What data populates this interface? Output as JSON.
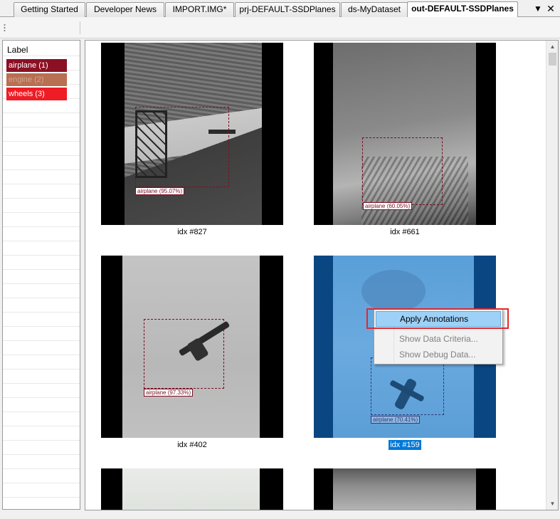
{
  "tabs": [
    {
      "label": "Getting Started",
      "active": false
    },
    {
      "label": "Developer News",
      "active": false
    },
    {
      "label": "IMPORT.IMG*",
      "active": false
    },
    {
      "label": "prj-DEFAULT-SSDPlanes",
      "active": false
    },
    {
      "label": "ds-MyDataset",
      "active": false
    },
    {
      "label": "out-DEFAULT-SSDPlanes",
      "active": true
    }
  ],
  "tab_controls": {
    "dropdown_icon": "chevron-down-icon",
    "close_icon": "close-icon"
  },
  "label_panel": {
    "header": "Label",
    "items": [
      {
        "label": "airplane (1)",
        "color": "#8b1024"
      },
      {
        "label": "engine (2)",
        "color": "#b86f52"
      },
      {
        "label": "wheels (3)",
        "color": "#ee1c25"
      }
    ]
  },
  "grid": {
    "items": [
      {
        "caption": "idx #827",
        "box_label": "airplane (95.07%)",
        "selected": false
      },
      {
        "caption": "idx #661",
        "box_label": "airplane (60.05%)",
        "selected": false
      },
      {
        "caption": "idx #402",
        "box_label": "airplane (97.33%)",
        "selected": false
      },
      {
        "caption": "idx #159",
        "box_label": "airplane (70.41%)",
        "selected": true
      }
    ]
  },
  "context_menu": {
    "items": [
      {
        "label": "Apply Annotations",
        "highlighted": true,
        "enabled": true
      },
      {
        "label": "Show Data Criteria...",
        "highlighted": false,
        "enabled": false
      },
      {
        "label": "Show Debug Data...",
        "highlighted": false,
        "enabled": false
      }
    ]
  }
}
